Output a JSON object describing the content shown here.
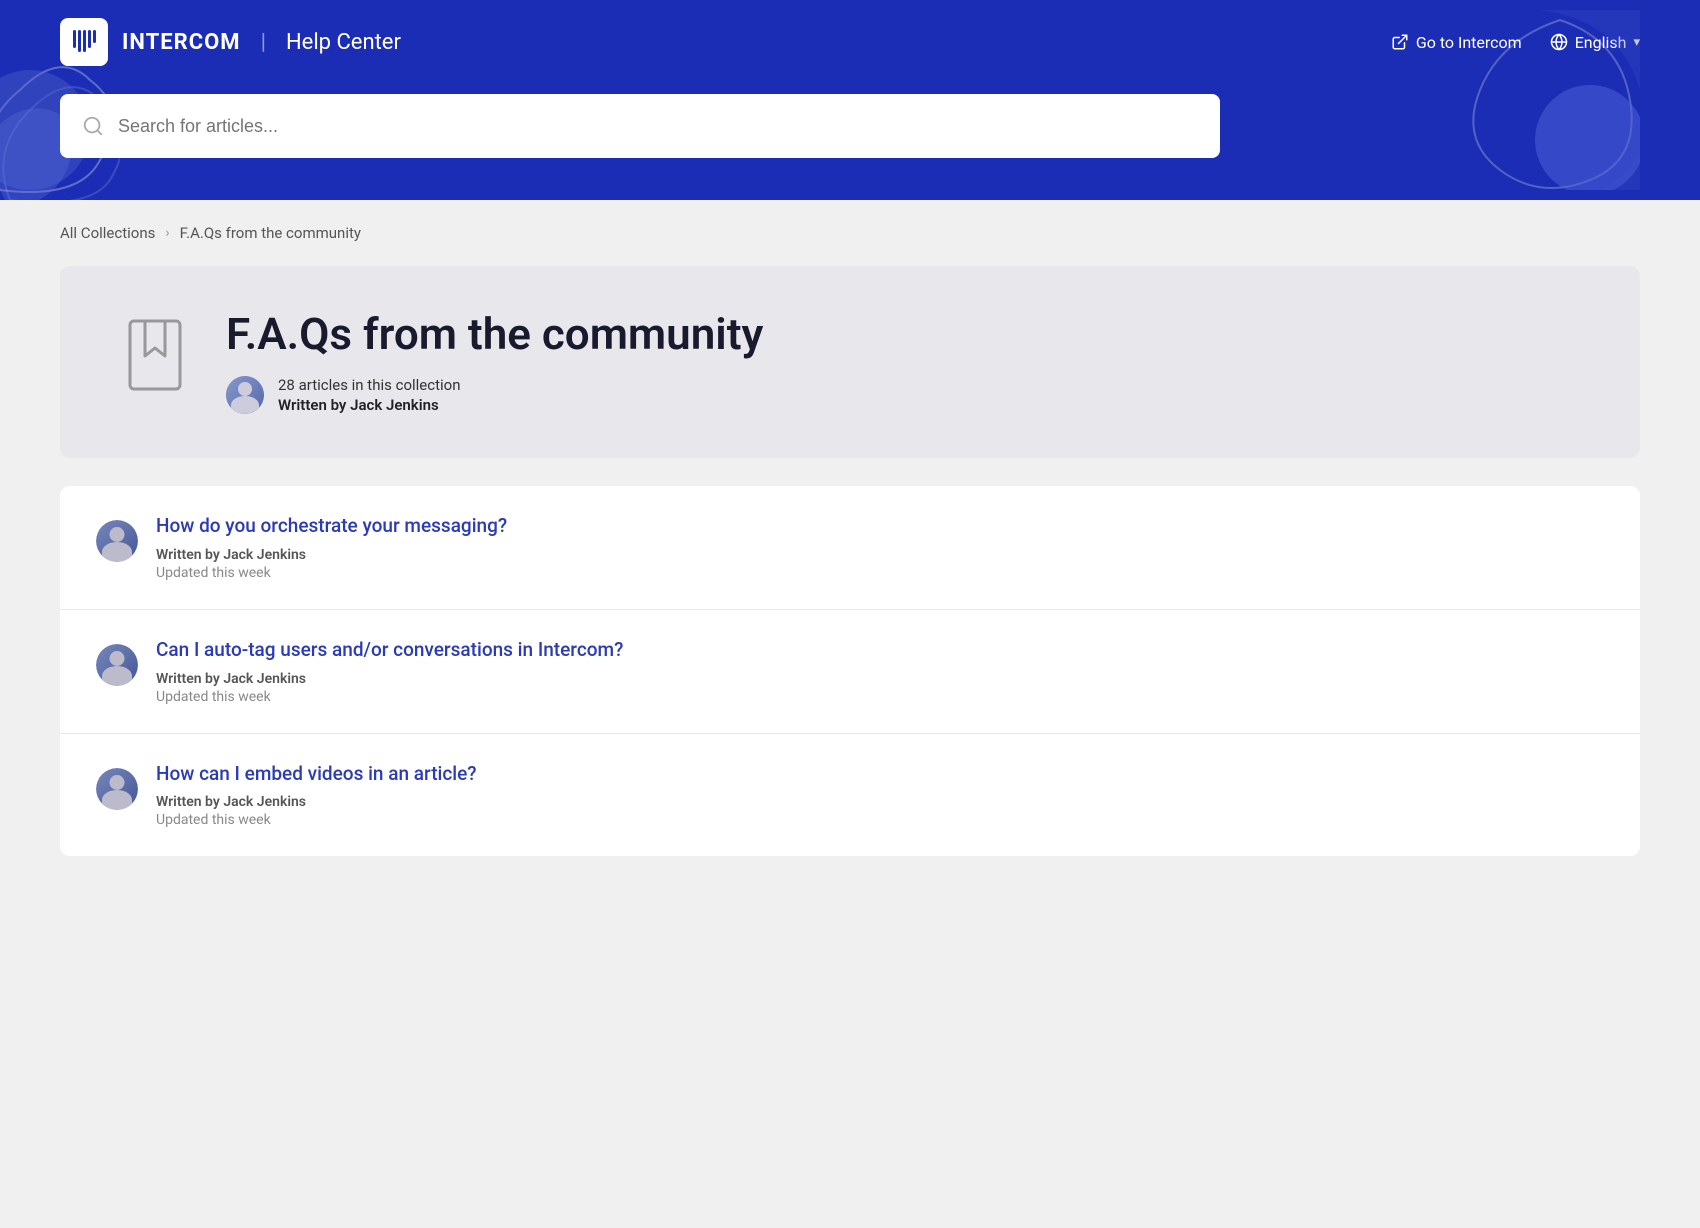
{
  "header": {
    "logo_text": "INTERCOM",
    "divider": "|",
    "help_center": "Help Center",
    "go_to_intercom": "Go to Intercom",
    "language": "English",
    "search_placeholder": "Search for articles..."
  },
  "breadcrumb": {
    "all_collections": "All Collections",
    "current": "F.A.Qs from the community"
  },
  "collection": {
    "title": "F.A.Qs from the community",
    "articles_count": "28 articles in this collection",
    "written_by_label": "Written by",
    "author": "Jack Jenkins"
  },
  "articles": [
    {
      "title": "How do you orchestrate your messaging?",
      "written_by_label": "Written by",
      "author": "Jack Jenkins",
      "updated": "Updated this week"
    },
    {
      "title": "Can I auto-tag users and/or conversations in Intercom?",
      "written_by_label": "Written by",
      "author": "Jack Jenkins",
      "updated": "Updated this week"
    },
    {
      "title": "How can I embed videos in an article?",
      "written_by_label": "Written by",
      "author": "Jack Jenkins",
      "updated": "Updated this week"
    }
  ]
}
